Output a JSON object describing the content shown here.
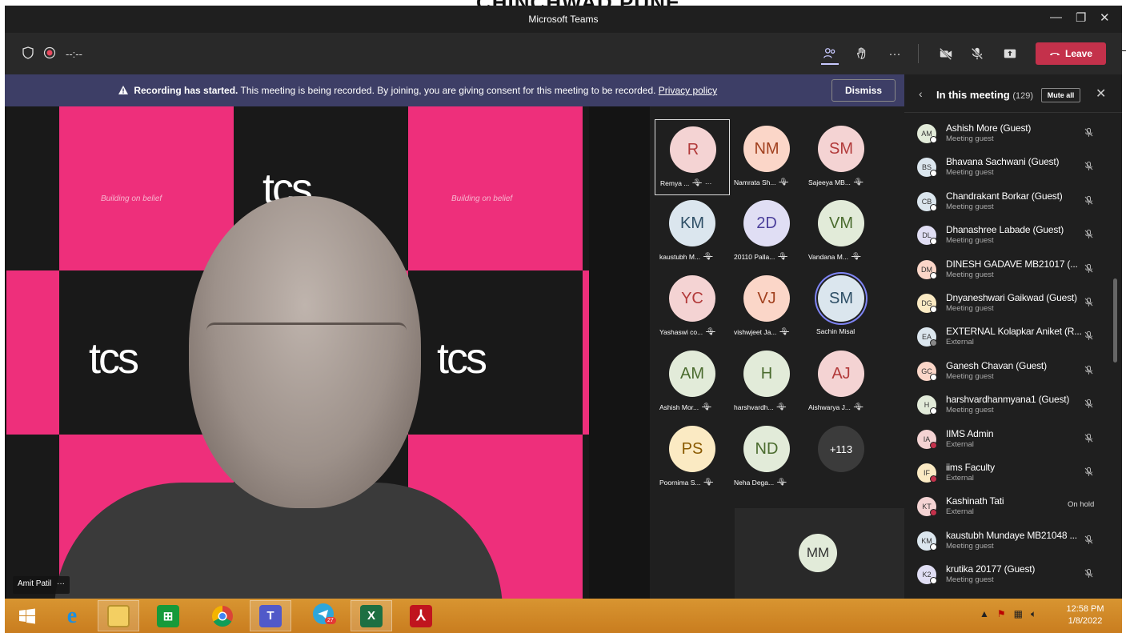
{
  "overlay_text": "CHINCHWAD PUNE",
  "window": {
    "title": "Microsoft Teams",
    "minimize": "—",
    "maximize": "❐",
    "close": "✕"
  },
  "toolbar": {
    "timer": "--:--",
    "more": "···",
    "leave_label": "Leave"
  },
  "banner": {
    "bold": "Recording has started.",
    "text": " This meeting is being recorded. By joining, you are giving consent for this meeting to be recorded. ",
    "link": "Privacy policy",
    "dismiss": "Dismiss"
  },
  "stage": {
    "speaker_name": "Amit Patil",
    "speaker_more": "···",
    "brand_word": "tcs",
    "tagline": "Building on belief"
  },
  "grid": [
    {
      "initials": "R",
      "label": "Remya ...",
      "bg": "#f4d3d3",
      "fg": "#b23a3a",
      "extra": "···"
    },
    {
      "initials": "NM",
      "label": "Namrata Sh...",
      "bg": "#fbd6c8",
      "fg": "#a1401e"
    },
    {
      "initials": "SM",
      "label": "Sajeeya MB...",
      "bg": "#f4d3d3",
      "fg": "#b23a3a"
    },
    {
      "initials": "KM",
      "label": "kaustubh M...",
      "bg": "#dbe6ee",
      "fg": "#2e4f66"
    },
    {
      "initials": "2D",
      "label": "20110 Palla...",
      "bg": "#e0def4",
      "fg": "#4b3f9b"
    },
    {
      "initials": "VM",
      "label": "Vandana M...",
      "bg": "#e2ebd9",
      "fg": "#4a6b2e"
    },
    {
      "initials": "YC",
      "label": "Yashaswi co...",
      "bg": "#f4d3d3",
      "fg": "#b23a3a"
    },
    {
      "initials": "VJ",
      "label": "vishwjeet Ja...",
      "bg": "#fbd6c8",
      "fg": "#a1401e"
    },
    {
      "initials": "SM",
      "label": "Sachin Misal",
      "bg": "#dbe6ee",
      "fg": "#2e4f66",
      "speaking": true
    },
    {
      "initials": "AM",
      "label": "Ashish Mor...",
      "bg": "#e2ebd9",
      "fg": "#4a6b2e"
    },
    {
      "initials": "H",
      "label": "harshvardh...",
      "bg": "#e2ebd9",
      "fg": "#4a6b2e"
    },
    {
      "initials": "AJ",
      "label": "Aishwarya J...",
      "bg": "#f4d3d3",
      "fg": "#b23a3a"
    },
    {
      "initials": "PS",
      "label": "Poornima S...",
      "bg": "#fbeac3",
      "fg": "#8a5a00"
    },
    {
      "initials": "ND",
      "label": "Neha Dega...",
      "bg": "#e2ebd9",
      "fg": "#4a6b2e"
    },
    {
      "initials": "+113",
      "label": "",
      "bg": "#3b3b3b",
      "fg": "#ffffff"
    }
  ],
  "extra_tile": {
    "initials": "MM"
  },
  "panel": {
    "title": "In this meeting",
    "count": "(129)",
    "mute_all": "Mute all",
    "participants": [
      {
        "initials": "AM",
        "name": "Ashish More (Guest)",
        "role": "Meeting guest",
        "bg": "#e2ebd9",
        "dot": "#ffffff"
      },
      {
        "initials": "BS",
        "name": "Bhavana Sachwani (Guest)",
        "role": "Meeting guest",
        "bg": "#dbe6ee",
        "dot": "#ffffff"
      },
      {
        "initials": "CB",
        "name": "Chandrakant Borkar (Guest)",
        "role": "Meeting guest",
        "bg": "#dbe6ee",
        "dot": "#ffffff"
      },
      {
        "initials": "DL",
        "name": "Dhanashree Labade (Guest)",
        "role": "Meeting guest",
        "bg": "#e0def4",
        "dot": "#ffffff"
      },
      {
        "initials": "DM",
        "name": "DINESH GADAVE MB21017 (...",
        "role": "Meeting guest",
        "bg": "#fbd6c8",
        "dot": "#ffffff"
      },
      {
        "initials": "DG",
        "name": "Dnyaneshwari Gaikwad (Guest)",
        "role": "Meeting guest",
        "bg": "#fbeac3",
        "dot": "#ffffff"
      },
      {
        "initials": "EA",
        "name": "EXTERNAL Kolapkar Aniket (R...",
        "role": "External",
        "bg": "#dbe6ee",
        "dot": "#888888"
      },
      {
        "initials": "GC",
        "name": "Ganesh Chavan (Guest)",
        "role": "Meeting guest",
        "bg": "#fbd6c8",
        "dot": "#ffffff"
      },
      {
        "initials": "H",
        "name": "harshvardhanmyana1 (Guest)",
        "role": "Meeting guest",
        "bg": "#e2ebd9",
        "dot": "#ffffff"
      },
      {
        "initials": "IA",
        "name": "IIMS Admin",
        "role": "External",
        "bg": "#f4d3d3",
        "dot": "#c4314b"
      },
      {
        "initials": "IF",
        "name": "iims Faculty",
        "role": "External",
        "bg": "#fbeac3",
        "dot": "#c4314b"
      },
      {
        "initials": "KT",
        "name": "Kashinath Tati",
        "role": "External",
        "bg": "#f4d3d3",
        "dot": "#c4314b",
        "status": "On hold"
      },
      {
        "initials": "KM",
        "name": "kaustubh Mundaye MB21048 ...",
        "role": "Meeting guest",
        "bg": "#dbe6ee",
        "dot": "#ffffff"
      },
      {
        "initials": "K2",
        "name": "krutika 20177 (Guest)",
        "role": "Meeting guest",
        "bg": "#e0def4",
        "dot": "#ffffff"
      }
    ]
  },
  "taskbar": {
    "telegram_badge": "27",
    "time": "12:58 PM",
    "date": "1/8/2022"
  }
}
